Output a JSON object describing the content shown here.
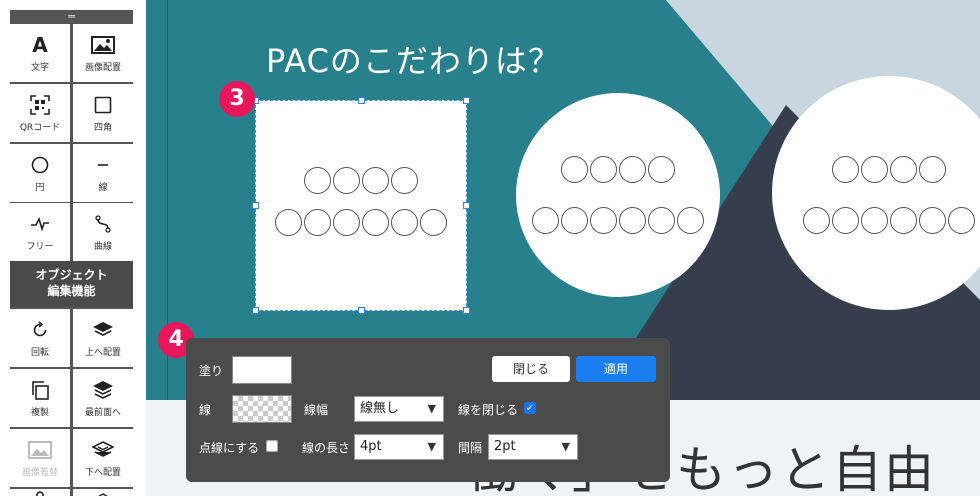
{
  "palette": {
    "grip": "═",
    "tools": [
      {
        "label": "文字",
        "icon": "text-icon"
      },
      {
        "label": "画像配置",
        "icon": "image-icon"
      },
      {
        "label": "QRコード",
        "icon": "qr-code-icon"
      },
      {
        "label": "四角",
        "icon": "square-icon"
      },
      {
        "label": "円",
        "icon": "circle-icon"
      },
      {
        "label": "線",
        "icon": "line-icon"
      },
      {
        "label": "フリー",
        "icon": "freehand-icon"
      },
      {
        "label": "曲線",
        "icon": "curve-icon"
      }
    ],
    "section_title": "オブジェクト\n編集機能",
    "edit_tools": [
      {
        "label": "回転",
        "icon": "rotate-icon"
      },
      {
        "label": "上へ配置",
        "icon": "layer-up-icon"
      },
      {
        "label": "複製",
        "icon": "duplicate-icon"
      },
      {
        "label": "最前面へ",
        "icon": "bring-front-icon"
      },
      {
        "label": "画像差替",
        "icon": "image-replace-icon"
      },
      {
        "label": "下へ配置",
        "icon": "layer-down-icon"
      }
    ]
  },
  "slide": {
    "title": "PACのこだわりは？",
    "bottom_text": "「働く」をもっと自由",
    "ring_rows": [
      4,
      6
    ],
    "colors": {
      "teal": "#2a7f8c",
      "navy": "#363d4d",
      "badge": "#e8165a"
    }
  },
  "badges": {
    "step3": "3",
    "step4": "4"
  },
  "props": {
    "fill_label": "塗り",
    "stroke_label": "線",
    "stroke_width_label": "線幅",
    "stroke_width_value": "線無し",
    "close_path_label": "線を閉じる",
    "close_path_checked": true,
    "dashed_label": "点線にする",
    "dashed_checked": false,
    "dash_length_label": "線の長さ",
    "dash_length_value": "4pt",
    "gap_label": "間隔",
    "gap_value": "2pt",
    "close_button": "閉じる",
    "apply_button": "適用"
  }
}
